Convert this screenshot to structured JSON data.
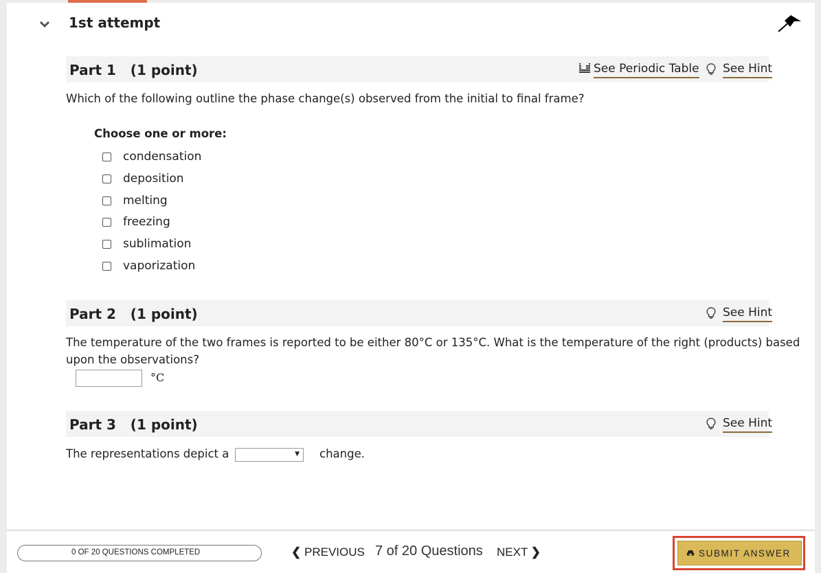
{
  "attempt": {
    "title": "1st attempt"
  },
  "part1": {
    "title": "Part 1   (1 point)",
    "periodic_table_link": "See Periodic Table",
    "hint_link": "See Hint",
    "question": "Which of the following outline the phase change(s) observed from the initial to final frame?",
    "choose_label": "Choose one or more:",
    "options": [
      "condensation",
      "deposition",
      "melting",
      "freezing",
      "sublimation",
      "vaporization"
    ]
  },
  "part2": {
    "title": "Part 2   (1 point)",
    "hint_link": "See Hint",
    "question_line1": "The temperature of the two frames is reported to be either 80°C or 135°C. What is the temperature of the right (products) based",
    "question_line2": "upon the observations?",
    "input_value": "",
    "unit": "°C"
  },
  "part3": {
    "title": "Part 3   (1 point)",
    "hint_link": "See Hint",
    "text_before": "The representations depict a",
    "select_value": "",
    "text_after": "change."
  },
  "footer": {
    "progress_text": "0 OF 20 QUESTIONS COMPLETED",
    "progress_fraction": 0,
    "previous_label": "PREVIOUS",
    "question_counter": "7 of 20 Questions",
    "next_label": "NEXT",
    "submit_label": "SUBMIT ANSWER"
  },
  "colors": {
    "accent": "#e06c4a",
    "submit_button": "#d9b958",
    "highlight_outline": "#d9442f",
    "link_underline": "#8a6a3a"
  }
}
